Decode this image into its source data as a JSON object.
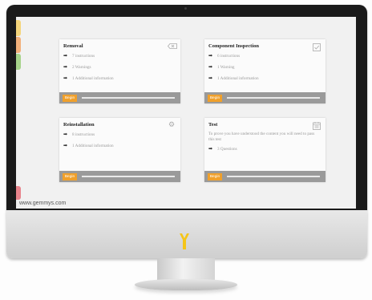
{
  "site": {
    "watermark": "www.gemmys.com"
  },
  "monitor": {
    "logo_color": "#f5c518"
  },
  "side_tabs": [
    {
      "color": "#f5d57a"
    },
    {
      "color": "#f2b07a"
    },
    {
      "color": "#a6d38a"
    },
    {
      "color": "#e8848c"
    }
  ],
  "cards": [
    {
      "title": "Removal",
      "icon": "eraser-icon",
      "items": [
        "7 instructions",
        "2 Warnings",
        "1 Additional information"
      ],
      "button": "Begin",
      "progress": 0
    },
    {
      "title": "Component Inspection",
      "icon": "checkbox-icon",
      "items": [
        "6 instructions",
        "1 Warning",
        "1 Additional information"
      ],
      "button": "Begin",
      "progress": 0
    },
    {
      "title": "Reinstallation",
      "icon": "gear-icon",
      "items": [
        "8 instructions",
        "1 Additional information"
      ],
      "button": "Begin",
      "progress": 0
    },
    {
      "title": "Test",
      "icon": "calendar-icon",
      "description": "To prove you have understood the content you will need to pass this test",
      "items": [
        "3 Questions"
      ],
      "button": "Begin",
      "progress": 0
    }
  ]
}
